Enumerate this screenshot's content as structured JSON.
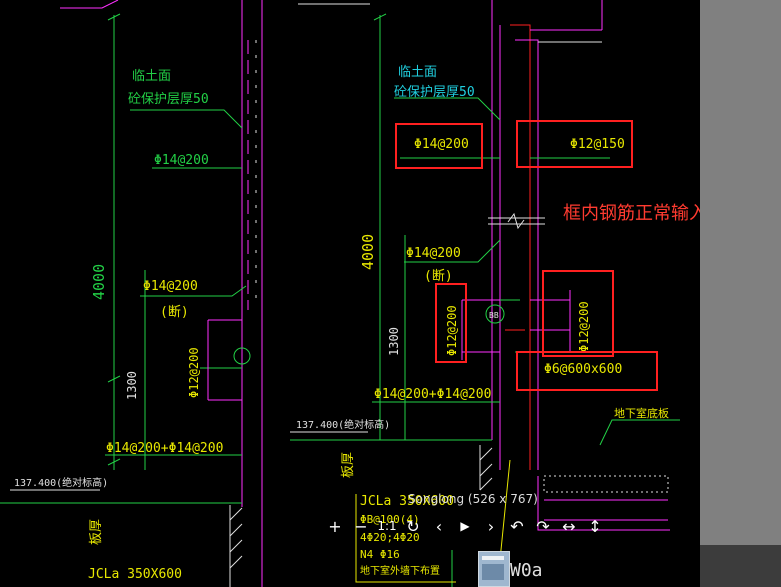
{
  "drawing": {
    "left": {
      "label_soil": "临土面",
      "label_cover": "砼保护层厚50",
      "rebar_top": "Φ14@200",
      "dim_height": "4000",
      "rebar_mid": "Φ14@200",
      "rebar_mid_note": "(断)",
      "rebar_vert": "Φ12@200",
      "dim_1300": "1300",
      "rebar_bottom": "Φ14@200+Φ14@200",
      "elevation": "137.400(绝对标高)",
      "slab_label": "板厚",
      "beam_label": "JCLa 350X600"
    },
    "right": {
      "label_soil": "临土面",
      "label_cover": "砼保护层厚50",
      "box_rebar_1": "Φ14@200",
      "box_rebar_2": "Φ12@150",
      "dim_height": "4000",
      "rebar_mid": "Φ14@200",
      "rebar_mid_note": "(断)",
      "box_rebar_3": "Φ12@200",
      "box_rebar_4": "Φ12@200",
      "bb_tag": "BB",
      "dim_1300": "1300",
      "rebar_bottom": "Φ14@200+Φ14@200",
      "box_rebar_5": "Φ6@600x600",
      "elevation": "137.400(绝对标高)",
      "slab_label": "板厚",
      "floor_label": "地下室底板",
      "beam_1": "JCLa 350X600",
      "beam_2": "ΦB@100(4)",
      "beam_3": "4Φ20;4Φ20",
      "beam_4": "N4 Φ16",
      "beam_5": "地下室外墙下布置",
      "beam_6": "W0a"
    }
  },
  "annotation": {
    "text": "框内钢筋正常输入",
    "box_color": "#ff2020"
  },
  "viewer": {
    "image_title": "Songlong (526 x 767)",
    "toolbar": {
      "zoom_in": "+",
      "zoom_out": "−",
      "actual_size": "1:1",
      "refresh": "↻",
      "prev": "‹",
      "play": "▶",
      "next": "›",
      "rotate_left": "↶",
      "rotate_right": "↷",
      "flip_h": "↔",
      "flip_v": "↕"
    }
  },
  "colors": {
    "background": "#000000",
    "sidebar": "#808080",
    "cad_green": "#22d046",
    "cad_yellow": "#e8e800",
    "cad_magenta": "#ff30ff",
    "cad_cyan": "#20d0e0",
    "cad_white": "#e0e0e0",
    "cad_red": "#ff2020"
  }
}
